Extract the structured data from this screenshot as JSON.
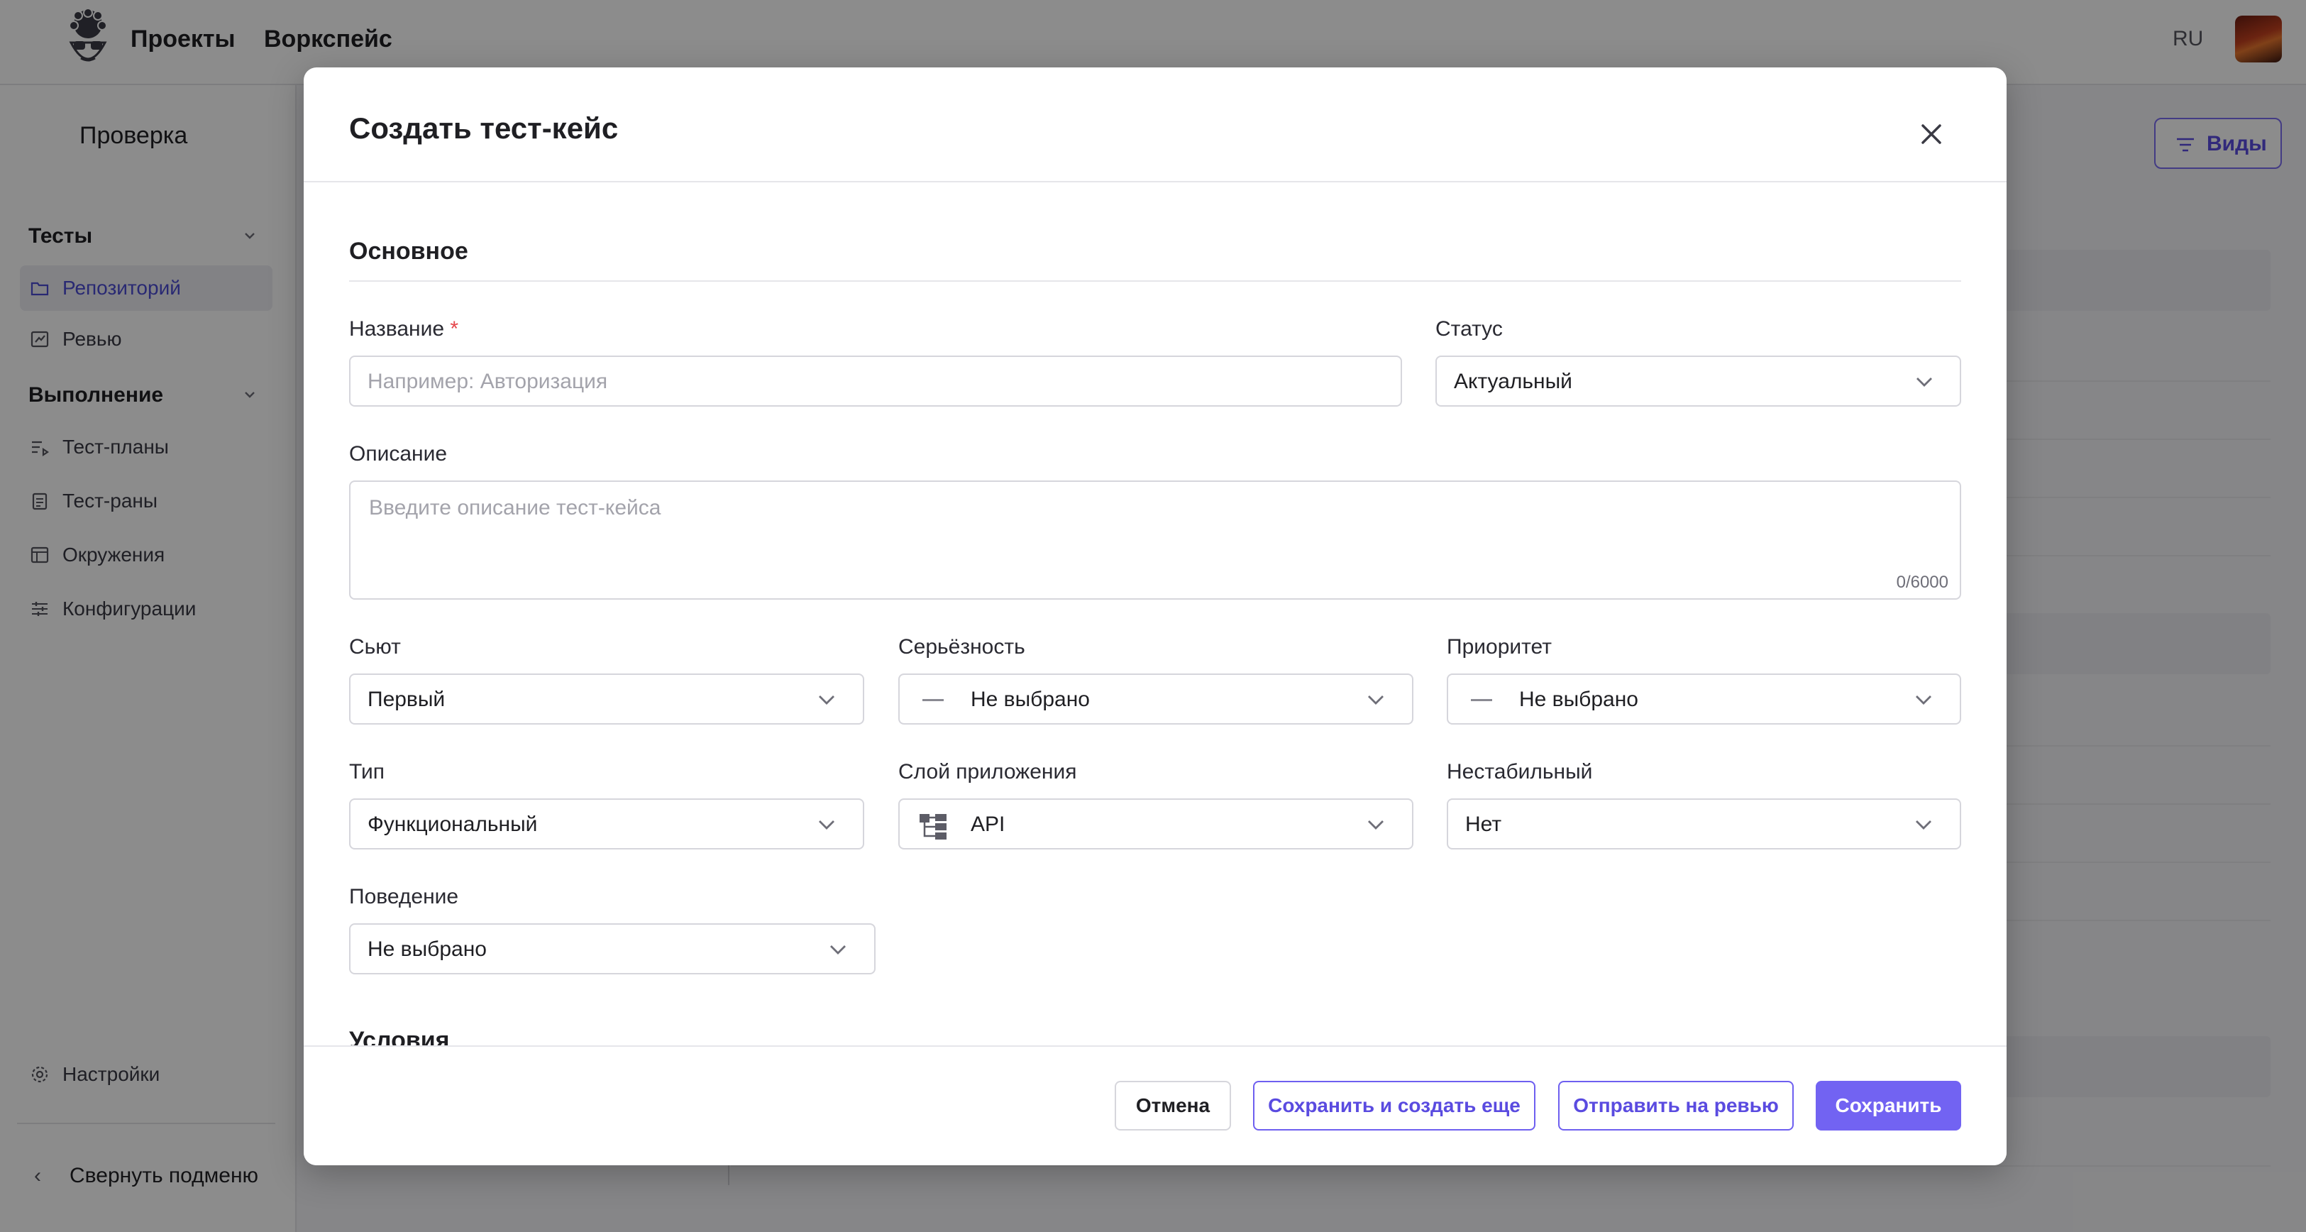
{
  "topbar": {
    "nav": [
      "Проекты",
      "Воркспейс"
    ],
    "lang": "RU"
  },
  "sidebar": {
    "project": "Проверка",
    "sections": [
      {
        "label": "Тесты",
        "items": [
          "Репозиторий",
          "Ревью"
        ]
      },
      {
        "label": "Выполнение",
        "items": [
          "Тест-планы",
          "Тест-раны",
          "Окружения",
          "Конфигурации"
        ]
      }
    ],
    "active_item": "Репозиторий",
    "settings": "Настройки",
    "collapse": "Свернуть подменю"
  },
  "page": {
    "views_button": "Виды"
  },
  "modal": {
    "title": "Создать тест-кейс",
    "section_main": "Основное",
    "section_conditions": "Условия",
    "fields": {
      "name": {
        "label": "Название",
        "required_mark": "*",
        "placeholder": "Например: Авторизация",
        "value": ""
      },
      "status": {
        "label": "Статус",
        "value": "Актуальный"
      },
      "description": {
        "label": "Описание",
        "placeholder": "Введите описание тест-кейса",
        "counter": "0/6000"
      },
      "suite": {
        "label": "Сьют",
        "value": "Первый"
      },
      "severity": {
        "label": "Серьёзность",
        "value": "Не выбрано"
      },
      "priority": {
        "label": "Приоритет",
        "value": "Не выбрано"
      },
      "type": {
        "label": "Тип",
        "value": "Функциональный"
      },
      "layer": {
        "label": "Слой приложения",
        "value": "API"
      },
      "flaky": {
        "label": "Нестабильный",
        "value": "Нет"
      },
      "behavior": {
        "label": "Поведение",
        "value": "Не выбрано"
      }
    },
    "buttons": {
      "cancel": "Отмена",
      "save_and_create": "Сохранить и создать еще",
      "send_review": "Отправить на ревью",
      "save": "Сохранить"
    }
  },
  "colors": {
    "accent": "#7263f2",
    "accent_text": "#5a4be0",
    "required": "#e5484d",
    "overlay": "rgba(0,0,0,0.45)"
  }
}
